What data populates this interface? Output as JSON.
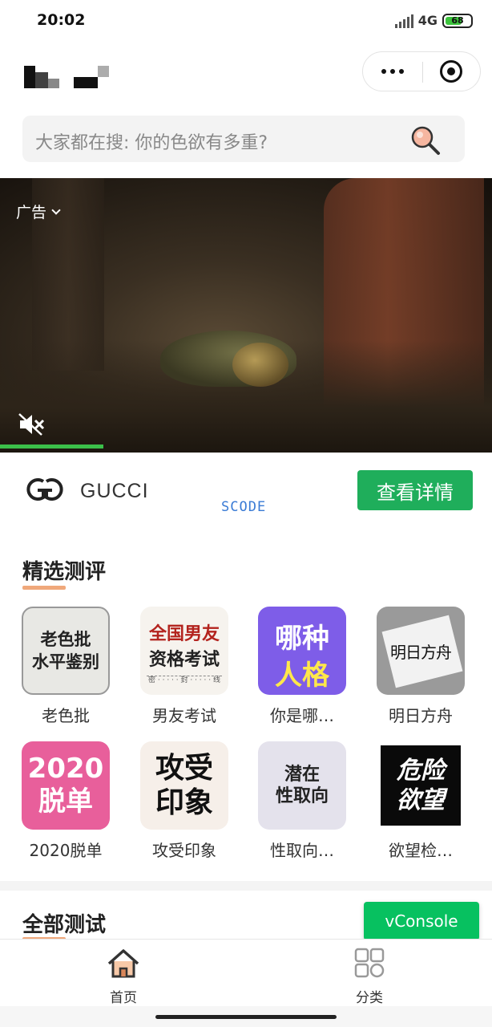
{
  "status_bar": {
    "time": "20:02",
    "network": "4G",
    "battery": "68"
  },
  "search": {
    "placeholder": "大家都在搜: 你的色欲有多重?"
  },
  "ad": {
    "label": "广告",
    "progress_fraction": 0.21
  },
  "brand": {
    "name": "GUCCI",
    "watermark": "SCODE",
    "detail_button": "查看详情"
  },
  "featured": {
    "title": "精选测评",
    "items": [
      {
        "label": "老色批",
        "thumb_text": "老色批\n水平鉴别"
      },
      {
        "label": "男友考试",
        "thumb_text_top": "全国男友",
        "thumb_text_mid": "资格考试",
        "thumb_text_bottom": "密 · · · · · 封 · · · · · 线"
      },
      {
        "label": "你是哪…",
        "thumb_text_top": "哪种",
        "thumb_text_bottom": "人格"
      },
      {
        "label": "明日方舟",
        "thumb_text": "明日方舟"
      },
      {
        "label": "2020脱单",
        "thumb_text": "2020\n脱单"
      },
      {
        "label": "攻受印象",
        "thumb_text": "攻受\n印象"
      },
      {
        "label": "性取向…",
        "thumb_text": "潜在\n性取向"
      },
      {
        "label": "欲望检…",
        "thumb_text": "危险\n欲望"
      }
    ]
  },
  "all_tests": {
    "title": "全部测试"
  },
  "vconsole": {
    "label": "vConsole"
  },
  "tabbar": {
    "home": "首页",
    "category": "分类"
  },
  "colors": {
    "accent_green": "#1fae5b",
    "vconsole_green": "#07c160",
    "underline_orange": "#f0a87b"
  }
}
